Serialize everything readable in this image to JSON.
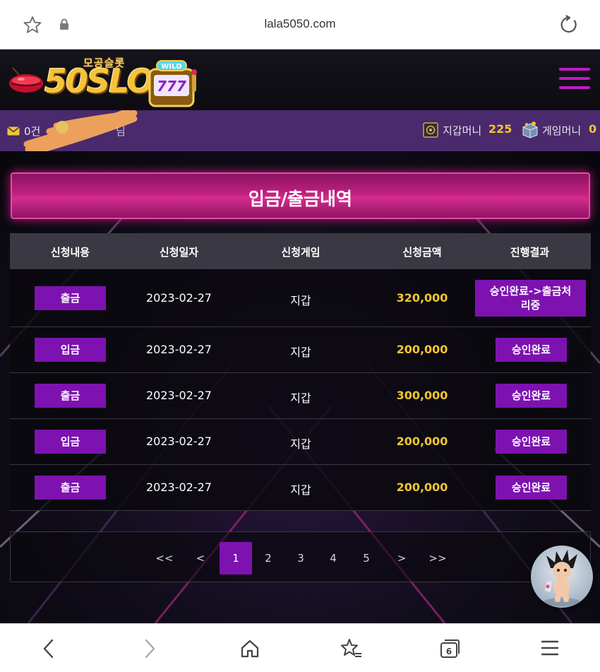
{
  "browser": {
    "url": "lala5050.com",
    "tab_count": "6"
  },
  "logo": {
    "sub": "모공슬롯",
    "main": "50SLOT",
    "wild": "WILD",
    "reels": "777"
  },
  "userbar": {
    "mail_count": "0건",
    "name_suffix": "님",
    "wallet_label": "지갑머니",
    "wallet_value": "225",
    "game_label": "게임머니",
    "game_value": "0"
  },
  "page": {
    "title": "입금/출금내역"
  },
  "table": {
    "headers": [
      "신청내용",
      "신청일자",
      "신청게임",
      "신청금액",
      "진행결과"
    ],
    "rows": [
      {
        "type": "출금",
        "date": "2023-02-27",
        "game": "지갑",
        "amount": "320,000",
        "status": "승인완료->출금처리중"
      },
      {
        "type": "입금",
        "date": "2023-02-27",
        "game": "지갑",
        "amount": "200,000",
        "status": "승인완료"
      },
      {
        "type": "출금",
        "date": "2023-02-27",
        "game": "지갑",
        "amount": "300,000",
        "status": "승인완료"
      },
      {
        "type": "입금",
        "date": "2023-02-27",
        "game": "지갑",
        "amount": "200,000",
        "status": "승인완료"
      },
      {
        "type": "출금",
        "date": "2023-02-27",
        "game": "지갑",
        "amount": "200,000",
        "status": "승인완료"
      }
    ]
  },
  "pagination": {
    "first": "<<",
    "prev": "<",
    "pages": [
      "1",
      "2",
      "3",
      "4",
      "5"
    ],
    "active": "1",
    "next": ">",
    "last": ">>"
  },
  "colors": {
    "accent_purple": "#7d12b0",
    "title_magenta": "#c0207f",
    "gold": "#f2c531",
    "userbar": "#4a2a6c"
  },
  "icons": {
    "favorite": "star-outline-icon",
    "lock": "lock-icon",
    "reload": "reload-icon",
    "menu": "hamburger-menu-icon",
    "mail": "mail-icon",
    "wallet": "safe-icon",
    "game_money": "treasure-box-icon",
    "back": "chevron-left-icon",
    "forward": "chevron-right-icon",
    "home": "home-icon",
    "bookmarks": "star-list-icon",
    "tabs": "tabs-icon",
    "browser_menu": "menu-icon"
  }
}
